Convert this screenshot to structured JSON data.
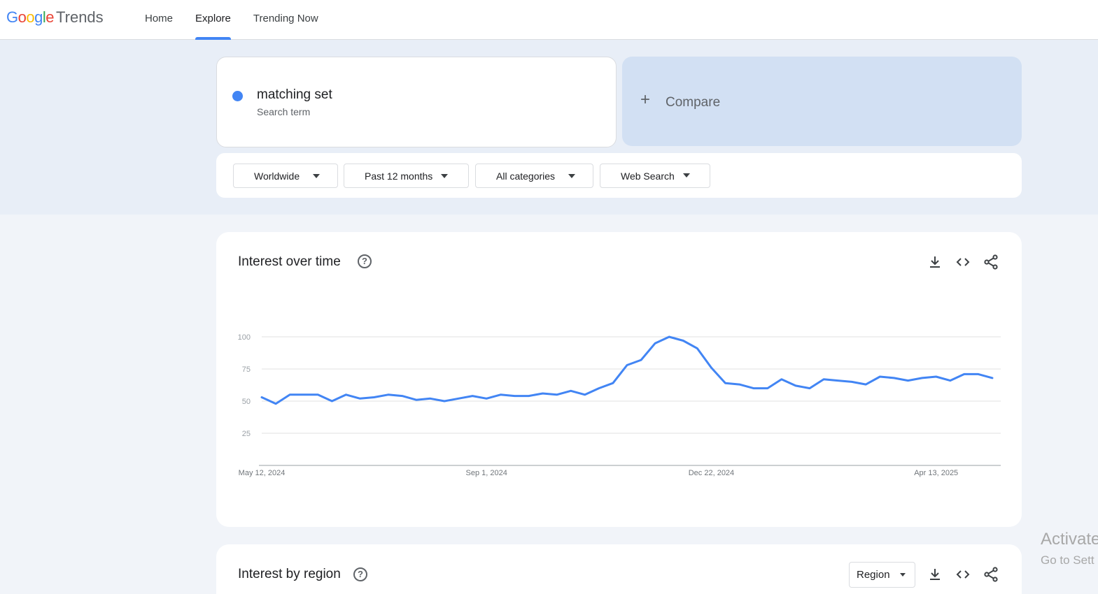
{
  "header": {
    "logo_google": [
      "G",
      "o",
      "o",
      "g",
      "l",
      "e"
    ],
    "logo_trends": "Trends",
    "nav": [
      {
        "label": "Home",
        "active": false
      },
      {
        "label": "Explore",
        "active": true
      },
      {
        "label": "Trending Now",
        "active": false
      }
    ]
  },
  "search": {
    "term": "matching set",
    "term_sub": "Search term",
    "term_color": "#4285f4",
    "compare_label": "Compare"
  },
  "filters": {
    "location": "Worldwide",
    "time": "Past 12 months",
    "category": "All categories",
    "property": "Web Search"
  },
  "interest_over_time": {
    "title": "Interest over time",
    "actions": [
      "download-icon",
      "embed-icon",
      "share-icon"
    ]
  },
  "interest_by_region": {
    "title": "Interest by region",
    "select_value": "Region",
    "actions": [
      "download-icon",
      "embed-icon",
      "share-icon"
    ]
  },
  "watermark": {
    "line1": "Activate",
    "line2": "Go to Sett"
  },
  "chart_data": {
    "type": "line",
    "title": "Interest over time",
    "xlabel": "",
    "ylabel": "",
    "ylim": [
      0,
      100
    ],
    "yticks": [
      25,
      50,
      75,
      100
    ],
    "x_tick_labels": [
      "May 12, 2024",
      "Sep 1, 2024",
      "Dec 22, 2024",
      "Apr 13, 2025"
    ],
    "x_tick_indices": [
      0,
      16,
      32,
      48
    ],
    "grid": true,
    "series": [
      {
        "color": "#4285f4",
        "values": [
          53,
          48,
          55,
          55,
          55,
          50,
          55,
          52,
          53,
          55,
          54,
          51,
          52,
          50,
          52,
          54,
          52,
          55,
          54,
          54,
          56,
          55,
          58,
          55,
          60,
          64,
          78,
          82,
          95,
          100,
          97,
          91,
          76,
          64,
          63,
          60,
          60,
          67,
          62,
          60,
          67,
          66,
          65,
          63,
          69,
          68,
          66,
          68,
          69,
          66,
          71,
          71,
          68
        ]
      }
    ]
  }
}
